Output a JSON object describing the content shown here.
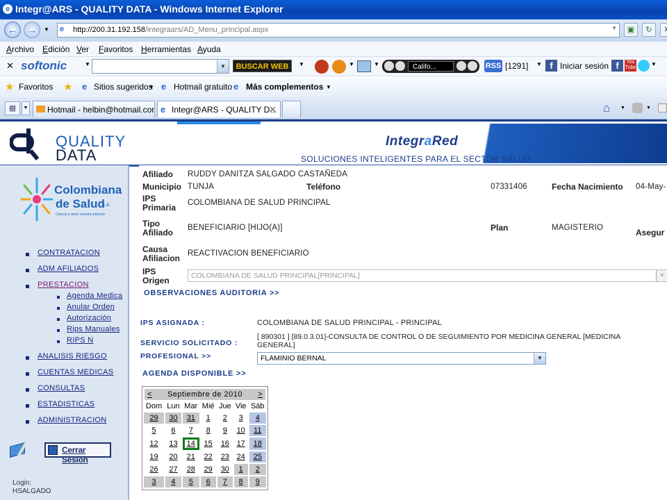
{
  "window": {
    "title": "Integr@ARS - QUALITY DATA - Windows Internet Explorer"
  },
  "address": {
    "host": "http://200.31.192.158",
    "path": "/integraars/AD_Menu_principal.aspx"
  },
  "menubar": [
    "Archivo",
    "Edición",
    "Ver",
    "Favoritos",
    "Herramientas",
    "Ayuda"
  ],
  "toolbar2": {
    "brand": "softonic",
    "search_btn": "BUSCAR WEB",
    "radio": "Califo...",
    "rss": "RSS",
    "rss_count": "[1291]",
    "fb_login": "Iniciar sesión"
  },
  "favbar": {
    "favorites": "Favoritos",
    "suggested": "Sitios sugeridos",
    "hotmail": "Hotmail gratuito",
    "more": "Más complementos"
  },
  "tabs": [
    {
      "label": "Hotmail - helbin@hotmail.com..."
    },
    {
      "label": "Integr@ARS - QUALITY D..."
    }
  ],
  "header": {
    "quality": "QUALITY",
    "data": "DATA",
    "integra": "Integr",
    "a": "a",
    "red": "Red",
    "tagline": "SOLUCIONES INTELIGENTES PARA EL SECTOR SALUD"
  },
  "sidebar": {
    "brand1": "Colombiana",
    "brand2": "de Salud",
    "brand_sa": "S.A.",
    "brand_motto": "Ciencia y amor nuestra solución",
    "items": [
      "CONTRATACION",
      "ADM AFILIADOS",
      "PRESTACION",
      "ANALISIS RIESGO",
      "CUENTAS MEDICAS",
      "CONSULTAS",
      "ESTADISTICAS",
      "ADMINISTRACION"
    ],
    "subitems": [
      "Agenda Medica",
      "Anular Orden",
      "Autorización",
      "Rips Manuales",
      "RIPS N"
    ],
    "logout": "Cerrar Sesión",
    "login_label": "Login:",
    "login_user": "HSALGADO"
  },
  "form": {
    "afiliado_lbl": "Afiliado",
    "afiliado": "RUDDY DANITZA SALGADO CASTAÑEDA",
    "municipio_lbl": "Municipio",
    "municipio": "TUNJA",
    "telefono_lbl": "Teléfono",
    "telefono": "07331406",
    "fecha_lbl": "Fecha Nacimiento",
    "fecha": "04-May-",
    "ips_lbl1": "IPS",
    "ips_lbl2": "Primaria",
    "ips": "COLOMBIANA DE SALUD PRINCIPAL",
    "tipo_lbl1": "Tipo",
    "tipo_lbl2": "Afiliado",
    "tipo": "BENEFICIARIO [HIJO(A)]",
    "plan_lbl": "Plan",
    "plan": "MAGISTERIO",
    "asegur_lbl": "Asegur",
    "causa_lbl1": "Causa",
    "causa_lbl2": "Afiliacion",
    "causa": "REACTIVACION BENEFICIARIO",
    "origen_lbl1": "IPS",
    "origen_lbl2": "Origen",
    "origen": "COLOMBIANA DE SALUD PRINCIPAL[PRINCIPAL]",
    "obs": "OBSERVACIONES AUDITORIA >>",
    "ips_asig_lbl": "IPS ASIGNADA :",
    "ips_asig": "COLOMBIANA DE SALUD PRINCIPAL - PRINCIPAL",
    "serv_lbl": "SERVICIO SOLICITADO :",
    "serv1": "[ 890301 ] [89.0.3.01]-CONSULTA DE CONTROL O DE SEGUIMIENTO POR MEDICINA GENERAL [MEDICINA",
    "serv2": "GENERAL]",
    "prof_lbl": "PROFESIONAL >>",
    "prof": "FLAMINIO BERNAL",
    "agenda": "AGENDA DISPONIBLE >>"
  },
  "calendar": {
    "prev": "<",
    "next": ">",
    "month": "Septiembre de 2010",
    "days": [
      "Dom",
      "Lun",
      "Mar",
      "Mié",
      "Jue",
      "Vie",
      "Sáb"
    ],
    "weeks": [
      [
        "29",
        "30",
        "31",
        "1",
        "2",
        "3",
        "4"
      ],
      [
        "5",
        "6",
        "7",
        "8",
        "9",
        "10",
        "11"
      ],
      [
        "12",
        "13",
        "14",
        "15",
        "16",
        "17",
        "18"
      ],
      [
        "19",
        "20",
        "21",
        "22",
        "23",
        "24",
        "25"
      ],
      [
        "26",
        "27",
        "28",
        "29",
        "30",
        "1",
        "2"
      ],
      [
        "3",
        "4",
        "5",
        "6",
        "7",
        "8",
        "9"
      ]
    ],
    "selected": "14"
  }
}
